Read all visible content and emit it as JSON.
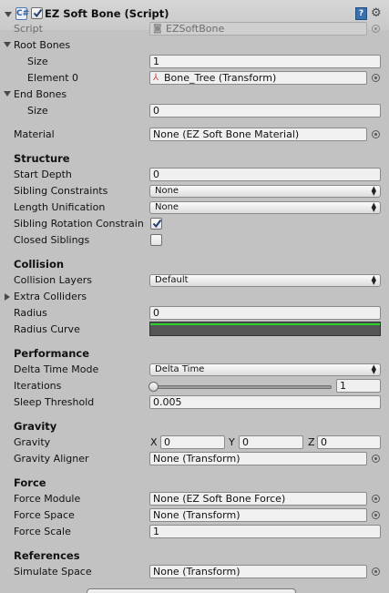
{
  "header": {
    "title": "EZ Soft Bone (Script)",
    "script_icon": "C#",
    "help_icon": "?"
  },
  "props": {
    "script": {
      "label": "Script",
      "value": "EZSoftBone"
    },
    "root_bones": {
      "label": "Root Bones",
      "size_label": "Size",
      "size": "1",
      "element0_label": "Element 0",
      "element0": "Bone_Tree (Transform)"
    },
    "end_bones": {
      "label": "End Bones",
      "size_label": "Size",
      "size": "0"
    },
    "material": {
      "label": "Material",
      "value": "None (EZ Soft Bone Material)"
    }
  },
  "structure": {
    "heading": "Structure",
    "start_depth": {
      "label": "Start Depth",
      "value": "0"
    },
    "sibling_constraints": {
      "label": "Sibling Constraints",
      "value": "None"
    },
    "length_unification": {
      "label": "Length Unification",
      "value": "None"
    },
    "sibling_rotation": {
      "label": "Sibling Rotation Constrain",
      "checked": true
    },
    "closed_siblings": {
      "label": "Closed Siblings",
      "checked": false
    }
  },
  "collision": {
    "heading": "Collision",
    "collision_layers": {
      "label": "Collision Layers",
      "value": "Default"
    },
    "extra_colliders": {
      "label": "Extra Colliders"
    },
    "radius": {
      "label": "Radius",
      "value": "0"
    },
    "radius_curve": {
      "label": "Radius Curve",
      "curve_color": "#2ad12a"
    }
  },
  "performance": {
    "heading": "Performance",
    "delta_time_mode": {
      "label": "Delta Time Mode",
      "value": "Delta Time"
    },
    "iterations": {
      "label": "Iterations",
      "value": "1",
      "slider_fraction": 0
    },
    "sleep_threshold": {
      "label": "Sleep Threshold",
      "value": "0.005"
    }
  },
  "gravity": {
    "heading": "Gravity",
    "gravity": {
      "label": "Gravity",
      "x_label": "X",
      "x": "0",
      "y_label": "Y",
      "y": "0",
      "z_label": "Z",
      "z": "0"
    },
    "gravity_aligner": {
      "label": "Gravity Aligner",
      "value": "None (Transform)"
    }
  },
  "force": {
    "heading": "Force",
    "force_module": {
      "label": "Force Module",
      "value": "None (EZ Soft Bone Force)"
    },
    "force_space": {
      "label": "Force Space",
      "value": "None (Transform)"
    },
    "force_scale": {
      "label": "Force Scale",
      "value": "1"
    }
  },
  "references": {
    "heading": "References",
    "simulate_space": {
      "label": "Simulate Space",
      "value": "None (Transform)"
    }
  },
  "colors": {
    "background": "#c2c2c2",
    "curve": "#2ad12a",
    "checkmark": "#1f3f73"
  }
}
